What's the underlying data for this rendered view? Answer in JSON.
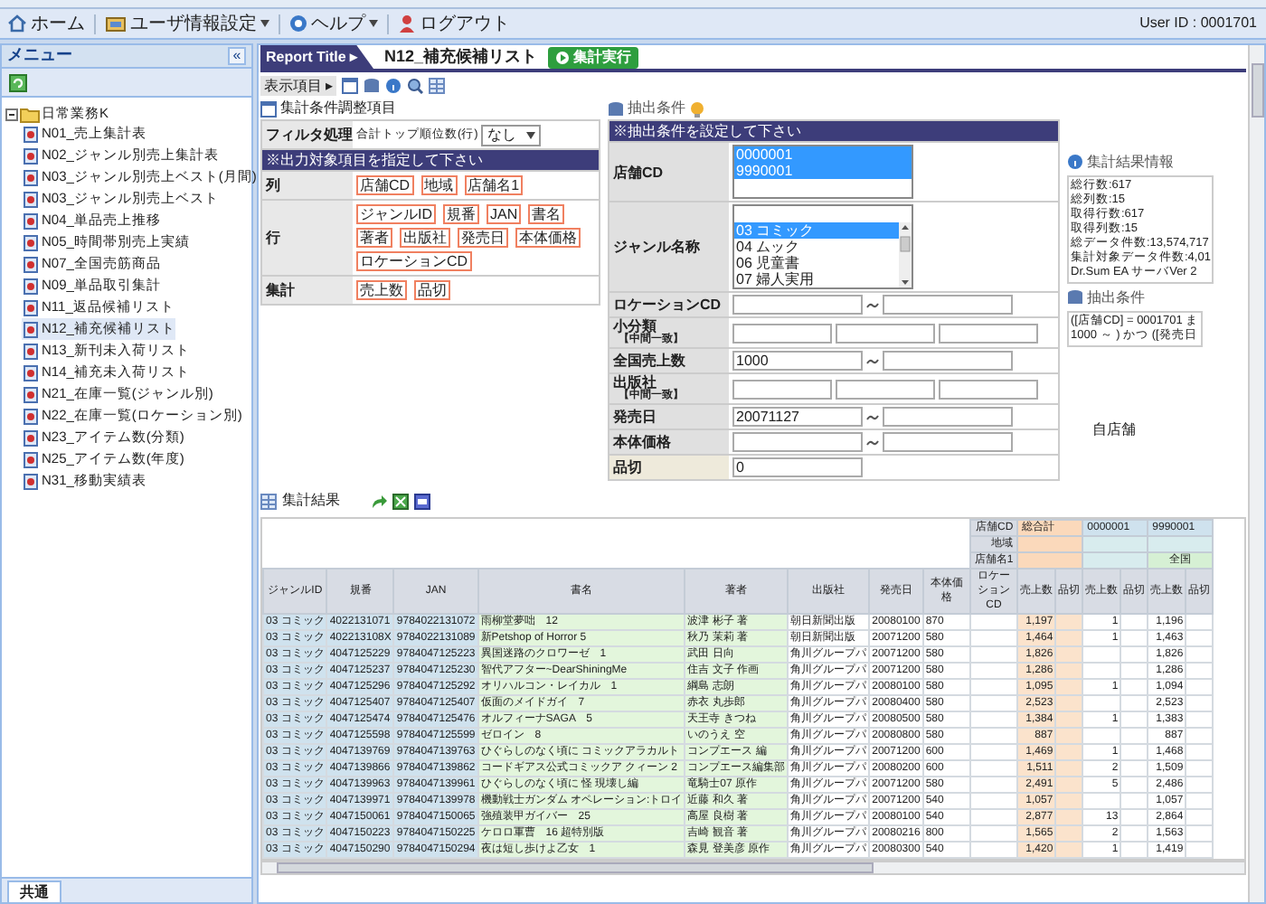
{
  "menubar": {
    "items": [
      {
        "label": "ホーム",
        "dropdown": false
      },
      {
        "label": "ユーザ情報設定",
        "dropdown": true
      },
      {
        "label": "ヘルプ",
        "dropdown": true
      },
      {
        "label": "ログアウト",
        "dropdown": false
      }
    ],
    "user_id": "User ID : 0001701"
  },
  "sidebar": {
    "title": "メニュー",
    "collapse": "«",
    "tree": [
      {
        "label": "日常業務K",
        "expanded": true,
        "children": [
          {
            "label": "N01_売上集計表",
            "selected": false
          },
          {
            "label": "N02_ジャンル別売上集計表",
            "selected": false
          },
          {
            "label": "N03_ジャンル別売上ベスト(月間)",
            "selected": false
          },
          {
            "label": "N03_ジャンル別売上ベスト",
            "selected": false
          },
          {
            "label": "N04_単品売上推移",
            "selected": false
          },
          {
            "label": "N05_時間帯別売上実績",
            "selected": false
          },
          {
            "label": "N07_全国売筋商品",
            "selected": false
          },
          {
            "label": "N09_単品取引集計",
            "selected": false
          },
          {
            "label": "N11_返品候補リスト",
            "selected": false
          },
          {
            "label": "N12_補充候補リスト",
            "selected": true
          },
          {
            "label": "N13_新刊未入荷リスト",
            "selected": false
          },
          {
            "label": "N14_補充未入荷リスト",
            "selected": false
          },
          {
            "label": "N21_在庫一覧(ジャンル別)",
            "selected": false
          },
          {
            "label": "N22_在庫一覧(ロケーション別)",
            "selected": false
          },
          {
            "label": "N23_アイテム数(分類)",
            "selected": false
          },
          {
            "label": "N25_アイテム数(年度)",
            "selected": false
          },
          {
            "label": "N31_移動実績表",
            "selected": false
          }
        ]
      }
    ],
    "bottom_tab": "共通"
  },
  "report": {
    "label": "Report Title ▸",
    "title": "N12_補充候補リスト",
    "run_button": "集計実行"
  },
  "toolbar": {
    "label": "表示項目 ▸"
  },
  "conditions": {
    "title": "集計条件調整項目",
    "filter_label": "フィルタ処理",
    "filter_text": "合計トップ順位数(行)",
    "filter_value": "なし",
    "notice": "※出力対象項目を指定して下さい",
    "groups": [
      {
        "label": "列",
        "items": [
          "店舗CD",
          "地域",
          "店舗名1"
        ]
      },
      {
        "label": "行",
        "items": [
          "ジャンルID",
          "規番",
          "JAN",
          "書名",
          "著者",
          "出版社",
          "発売日",
          "本体価格",
          "ロケーションCD"
        ]
      },
      {
        "label": "集計",
        "items": [
          "売上数",
          "品切"
        ]
      }
    ]
  },
  "extraction": {
    "title": "抽出条件",
    "notice": "※抽出条件を設定して下さい",
    "fields": [
      {
        "kind": "listbox",
        "label": "店舗CD",
        "highlight": false,
        "scroll": false,
        "options": [
          {
            "text": "0000001",
            "selected": true
          },
          {
            "text": "9990001",
            "selected": true
          }
        ]
      },
      {
        "kind": "listbox",
        "label": "ジャンル名称",
        "highlight": false,
        "scroll": true,
        "options": [
          {
            "text": "03 コミック",
            "selected": true
          },
          {
            "text": "04 ムック",
            "selected": false
          },
          {
            "text": "06 児童書",
            "selected": false
          },
          {
            "text": "07 婦人実用",
            "selected": false
          }
        ]
      },
      {
        "kind": "range",
        "label": "ロケーションCD",
        "highlight": false
      },
      {
        "kind": "triple",
        "label": "小分類",
        "note": "【中間一致】",
        "highlight": false
      },
      {
        "kind": "range",
        "label": "全国売上数",
        "highlight": false,
        "from": "1000"
      },
      {
        "kind": "triple",
        "label": "出版社",
        "note": "【中間一致】",
        "highlight": false
      },
      {
        "kind": "range",
        "label": "発売日",
        "highlight": false,
        "from": "20071127"
      },
      {
        "kind": "range",
        "label": "本体価格",
        "highlight": false
      },
      {
        "kind": "single",
        "label": "品切",
        "highlight": true,
        "value": "0"
      }
    ]
  },
  "info": {
    "title": "集計結果情報",
    "lines": [
      "総行数:617",
      "総列数:15",
      "取得行数:617",
      "取得列数:15",
      "総データ件数:13,574,717",
      "集計対象データ件数:4,01",
      "Dr.Sum EA サーバVer 2"
    ]
  },
  "summary": {
    "title": "抽出条件",
    "lines": [
      "([店舗CD] = 0001701 ま",
      "1000 ～ ) かつ ([発売日"
    ]
  },
  "note": "自店舗",
  "results": {
    "title": "集計結果",
    "pivot_labels": [
      "店舗CD",
      "地域",
      "店舗名1"
    ],
    "pivot_columns": [
      {
        "kind": "total",
        "store_cd": "総合計"
      },
      {
        "kind": "store",
        "store_cd": "0000001"
      },
      {
        "kind": "store",
        "store_cd": "9990001",
        "store_name": "全国"
      }
    ],
    "columns": [
      "ジャンルID",
      "規番",
      "JAN",
      "書名",
      "著者",
      "出版社",
      "発売日",
      "本体価格",
      "ロケーションCD",
      "売上数",
      "品切",
      "売上数",
      "品切",
      "売上数",
      "品切"
    ],
    "rows": [
      {
        "genre": "03 コミック",
        "code": "4022131071",
        "jan": "9784022131072",
        "title": "雨柳堂夢咄　12",
        "author": "波津 彬子 著",
        "publisher": "朝日新聞出版",
        "release": "20080100",
        "price": "870",
        "v0": "1,197",
        "v2": "1",
        "v4": "1,196"
      },
      {
        "genre": "03 コミック",
        "code": "402213108X",
        "jan": "9784022131089",
        "title": "新Petshop of Horror 5",
        "author": "秋乃 茉莉 著",
        "publisher": "朝日新聞出版",
        "release": "20071200",
        "price": "580",
        "v0": "1,464",
        "v2": "1",
        "v4": "1,463"
      },
      {
        "genre": "03 コミック",
        "code": "4047125229",
        "jan": "9784047125223",
        "title": "異国迷路のクロワーゼ　1",
        "author": "武田 日向",
        "publisher": "角川グループパ",
        "release": "20071200",
        "price": "580",
        "v0": "1,826",
        "v4": "1,826"
      },
      {
        "genre": "03 コミック",
        "code": "4047125237",
        "jan": "9784047125230",
        "title": "智代アフター~DearShiningMe",
        "author": "住吉 文子 作画",
        "publisher": "角川グループパ",
        "release": "20071200",
        "price": "580",
        "v0": "1,286",
        "v4": "1,286"
      },
      {
        "genre": "03 コミック",
        "code": "4047125296",
        "jan": "9784047125292",
        "title": "オリハルコン・レイカル　1",
        "author": "綱島 志朗",
        "publisher": "角川グループパ",
        "release": "20080100",
        "price": "580",
        "v0": "1,095",
        "v2": "1",
        "v4": "1,094"
      },
      {
        "genre": "03 コミック",
        "code": "4047125407",
        "jan": "9784047125407",
        "title": "仮面のメイドガイ　7",
        "author": "赤衣 丸歩郎",
        "publisher": "角川グループパ",
        "release": "20080400",
        "price": "580",
        "v0": "2,523",
        "v4": "2,523"
      },
      {
        "genre": "03 コミック",
        "code": "4047125474",
        "jan": "9784047125476",
        "title": "オルフィーナSAGA　5",
        "author": "天王寺 きつね",
        "publisher": "角川グループパ",
        "release": "20080500",
        "price": "580",
        "v0": "1,384",
        "v2": "1",
        "v4": "1,383"
      },
      {
        "genre": "03 コミック",
        "code": "4047125598",
        "jan": "9784047125599",
        "title": "ゼロイン　8",
        "author": "いのうえ 空",
        "publisher": "角川グループパ",
        "release": "20080800",
        "price": "580",
        "v0": "887",
        "v4": "887"
      },
      {
        "genre": "03 コミック",
        "code": "4047139769",
        "jan": "9784047139763",
        "title": "ひぐらしのなく頃に コミックアラカルト",
        "author": "コンプエース 編",
        "publisher": "角川グループパ",
        "release": "20071200",
        "price": "600",
        "v0": "1,469",
        "v2": "1",
        "v4": "1,468"
      },
      {
        "genre": "03 コミック",
        "code": "4047139866",
        "jan": "9784047139862",
        "title": "コードギアス公式コミックア クィーン 2",
        "author": "コンプエース編集部",
        "publisher": "角川グループパ",
        "release": "20080200",
        "price": "600",
        "v0": "1,511",
        "v2": "2",
        "v4": "1,509"
      },
      {
        "genre": "03 コミック",
        "code": "4047139963",
        "jan": "9784047139961",
        "title": "ひぐらしのなく頃に 怪 現壊し編",
        "author": "竜騎士07 原作",
        "publisher": "角川グループパ",
        "release": "20071200",
        "price": "580",
        "v0": "2,491",
        "v2": "5",
        "v4": "2,486"
      },
      {
        "genre": "03 コミック",
        "code": "4047139971",
        "jan": "9784047139978",
        "title": "機動戦士ガンダム オペレーション:トロイ",
        "author": "近藤 和久 著",
        "publisher": "角川グループパ",
        "release": "20071200",
        "price": "540",
        "v0": "1,057",
        "v4": "1,057"
      },
      {
        "genre": "03 コミック",
        "code": "4047150061",
        "jan": "9784047150065",
        "title": "強殖装甲ガイバー　25",
        "author": "高屋 良樹 著",
        "publisher": "角川グループパ",
        "release": "20080100",
        "price": "540",
        "v0": "2,877",
        "v2": "13",
        "v4": "2,864"
      },
      {
        "genre": "03 コミック",
        "code": "4047150223",
        "jan": "9784047150225",
        "title": "ケロロ軍曹　16 超特別版",
        "author": "吉崎 観音 著",
        "publisher": "角川グループパ",
        "release": "20080216",
        "price": "800",
        "v0": "1,565",
        "v2": "2",
        "v4": "1,563"
      },
      {
        "genre": "03 コミック",
        "code": "4047150290",
        "jan": "9784047150294",
        "title": "夜は短し歩けよ乙女　1",
        "author": "森見 登美彦 原作",
        "publisher": "角川グループパ",
        "release": "20080300",
        "price": "540",
        "v0": "1,420",
        "v2": "1",
        "v4": "1,419"
      }
    ]
  }
}
